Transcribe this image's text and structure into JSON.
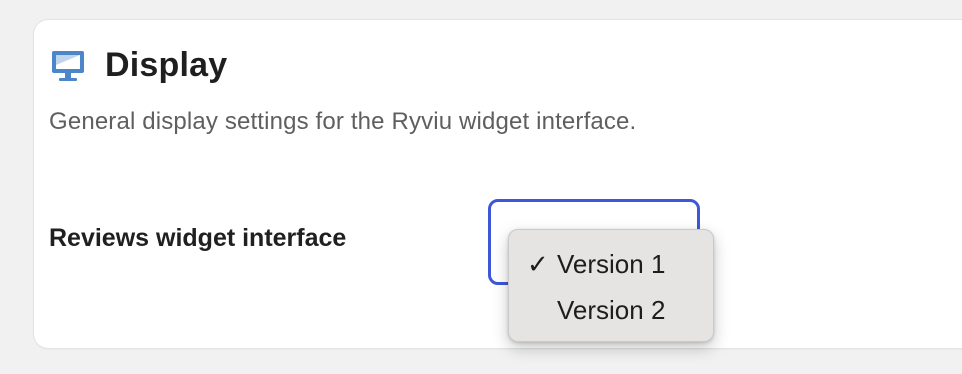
{
  "section": {
    "icon": "monitor-icon",
    "title": "Display",
    "description": "General display settings for the Ryviu widget interface."
  },
  "fields": {
    "reviews_widget_interface": {
      "label": "Reviews widget interface",
      "selected": "Version 1",
      "options": [
        {
          "label": "Version 1",
          "checked": true
        },
        {
          "label": "Version 2",
          "checked": false
        }
      ]
    }
  },
  "colors": {
    "icon_blue": "#4a86c8",
    "focus_ring": "#3d57d8",
    "menu_bg": "#e6e4e2"
  }
}
